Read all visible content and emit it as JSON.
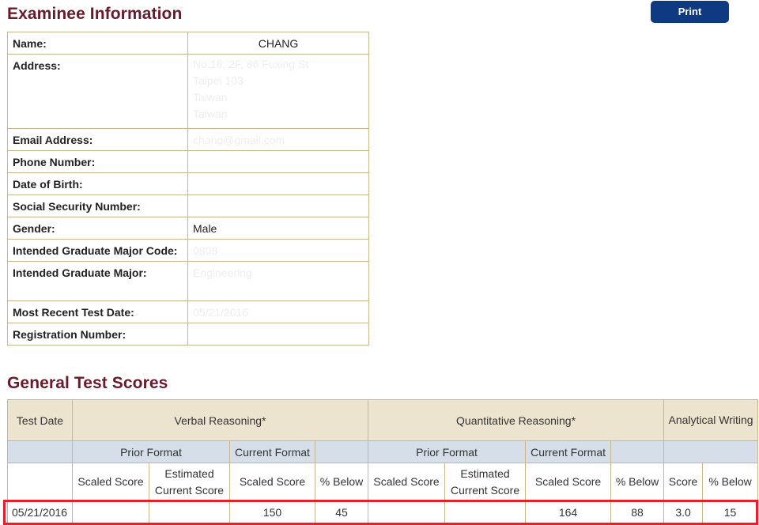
{
  "examinee": {
    "title": "Examinee Information",
    "print_label": "Print",
    "rows": [
      {
        "label": "Name:",
        "value": "CHANG"
      },
      {
        "label": "Address:",
        "value": [
          "No.18, 2F, 86 Fuxing St",
          "Taipei 103",
          "Taiwan",
          "Taiwan"
        ]
      },
      {
        "label": "Email Address:",
        "value": "chang@gmail.com"
      },
      {
        "label": "Phone Number:",
        "value": ""
      },
      {
        "label": "Date of Birth:",
        "value": ""
      },
      {
        "label": "Social Security Number:",
        "value": ""
      },
      {
        "label": "Gender:",
        "value": "Male"
      },
      {
        "label": "Intended Graduate Major Code:",
        "value": "0808"
      },
      {
        "label": "Intended Graduate Major:",
        "value": "Engineering"
      },
      {
        "label": "Most Recent Test Date:",
        "value": "05/21/2016"
      },
      {
        "label": "Registration Number:",
        "value": ""
      }
    ]
  },
  "scores": {
    "title": "General Test Scores",
    "headers": {
      "test_date": "Test Date",
      "verbal": "Verbal Reasoning*",
      "quant": "Quantitative Reasoning*",
      "writing": "Analytical Writing",
      "prior_format": "Prior Format",
      "current_format": "Current Format",
      "scaled_score": "Scaled Score",
      "estimated_current": "Estimated Current Score",
      "pct_below": "% Below",
      "score": "Score"
    },
    "row": {
      "test_date": "05/21/2016",
      "verbal_prior_scaled": "",
      "verbal_prior_estimated": "",
      "verbal_current_scaled": "150",
      "verbal_pct_below": "45",
      "quant_prior_scaled": "",
      "quant_prior_estimated": "",
      "quant_current_scaled": "164",
      "quant_pct_below": "88",
      "writing_score": "3.0",
      "writing_pct_below": "15"
    }
  },
  "colors": {
    "heading": "#6b1a2b",
    "print_button": "#0d3a80",
    "table_border": "#c9b78a",
    "header_tan": "#ede4cf",
    "header_blue": "#d6dfe9",
    "highlight": "#e0222a"
  }
}
